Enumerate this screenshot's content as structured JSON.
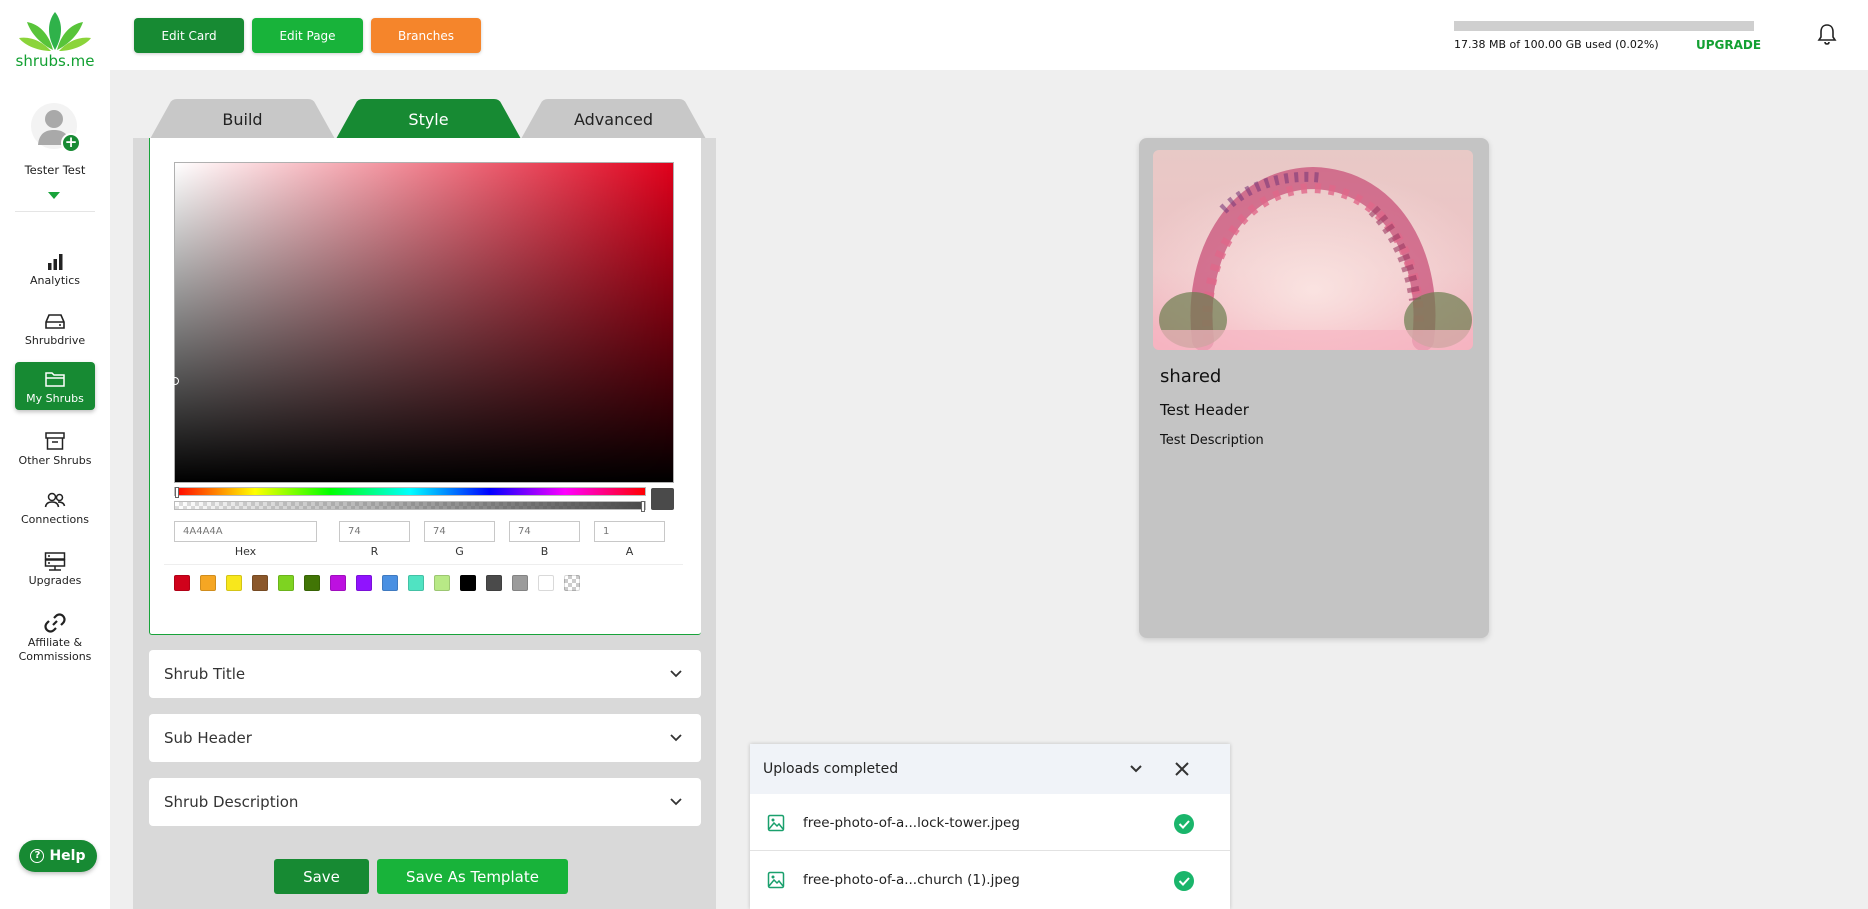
{
  "brand": {
    "name": "shrubs.me",
    "color": "#178a33"
  },
  "user": {
    "name": "Tester Test"
  },
  "nav": [
    {
      "label": "Analytics",
      "icon": "bar-chart-icon"
    },
    {
      "label": "Shrubdrive",
      "icon": "drive-icon"
    },
    {
      "label": "My Shrubs",
      "icon": "folder-icon",
      "active": true
    },
    {
      "label": "Other Shrubs",
      "icon": "archive-icon"
    },
    {
      "label": "Connections",
      "icon": "users-icon"
    },
    {
      "label": "Upgrades",
      "icon": "server-icon"
    },
    {
      "label": "Affiliate &\nCommissions",
      "icon": "link-icon"
    }
  ],
  "help": {
    "label": "Help"
  },
  "toolbar": {
    "edit_card": "Edit Card",
    "edit_page": "Edit Page",
    "branches": "Branches"
  },
  "storage": {
    "text": "17.38 MB of 100.00 GB used (0.02%)",
    "percent": 0.02,
    "upgrade": "UPGRADE"
  },
  "tabs": [
    {
      "label": "Build",
      "active": false
    },
    {
      "label": "Style",
      "active": true
    },
    {
      "label": "Advanced",
      "active": false
    }
  ],
  "color_picker": {
    "hex": "4A4A4A",
    "r": "74",
    "g": "74",
    "b": "74",
    "a": "1",
    "labels": {
      "hex": "Hex",
      "r": "R",
      "g": "G",
      "b": "B",
      "a": "A"
    },
    "swatches": [
      "#d0021b",
      "#f5a623",
      "#f8e71c",
      "#8b572a",
      "#7ed321",
      "#417505",
      "#bd10e0",
      "#9013fe",
      "#4a90e2",
      "#50e3c2",
      "#b8e986",
      "#000000",
      "#4a4a4a",
      "#9b9b9b",
      "#ffffff",
      "transparent"
    ]
  },
  "accordions": {
    "title": "Shrub Title",
    "sub_header": "Sub Header",
    "description": "Shrub Description"
  },
  "buttons": {
    "save": "Save",
    "save_template": "Save As Template"
  },
  "preview": {
    "title": "shared",
    "header": "Test Header",
    "description": "Test Description"
  },
  "uploads": {
    "title": "Uploads completed",
    "files": [
      "free-photo-of-a...lock-tower.jpeg",
      "free-photo-of-a...church (1).jpeg"
    ]
  }
}
